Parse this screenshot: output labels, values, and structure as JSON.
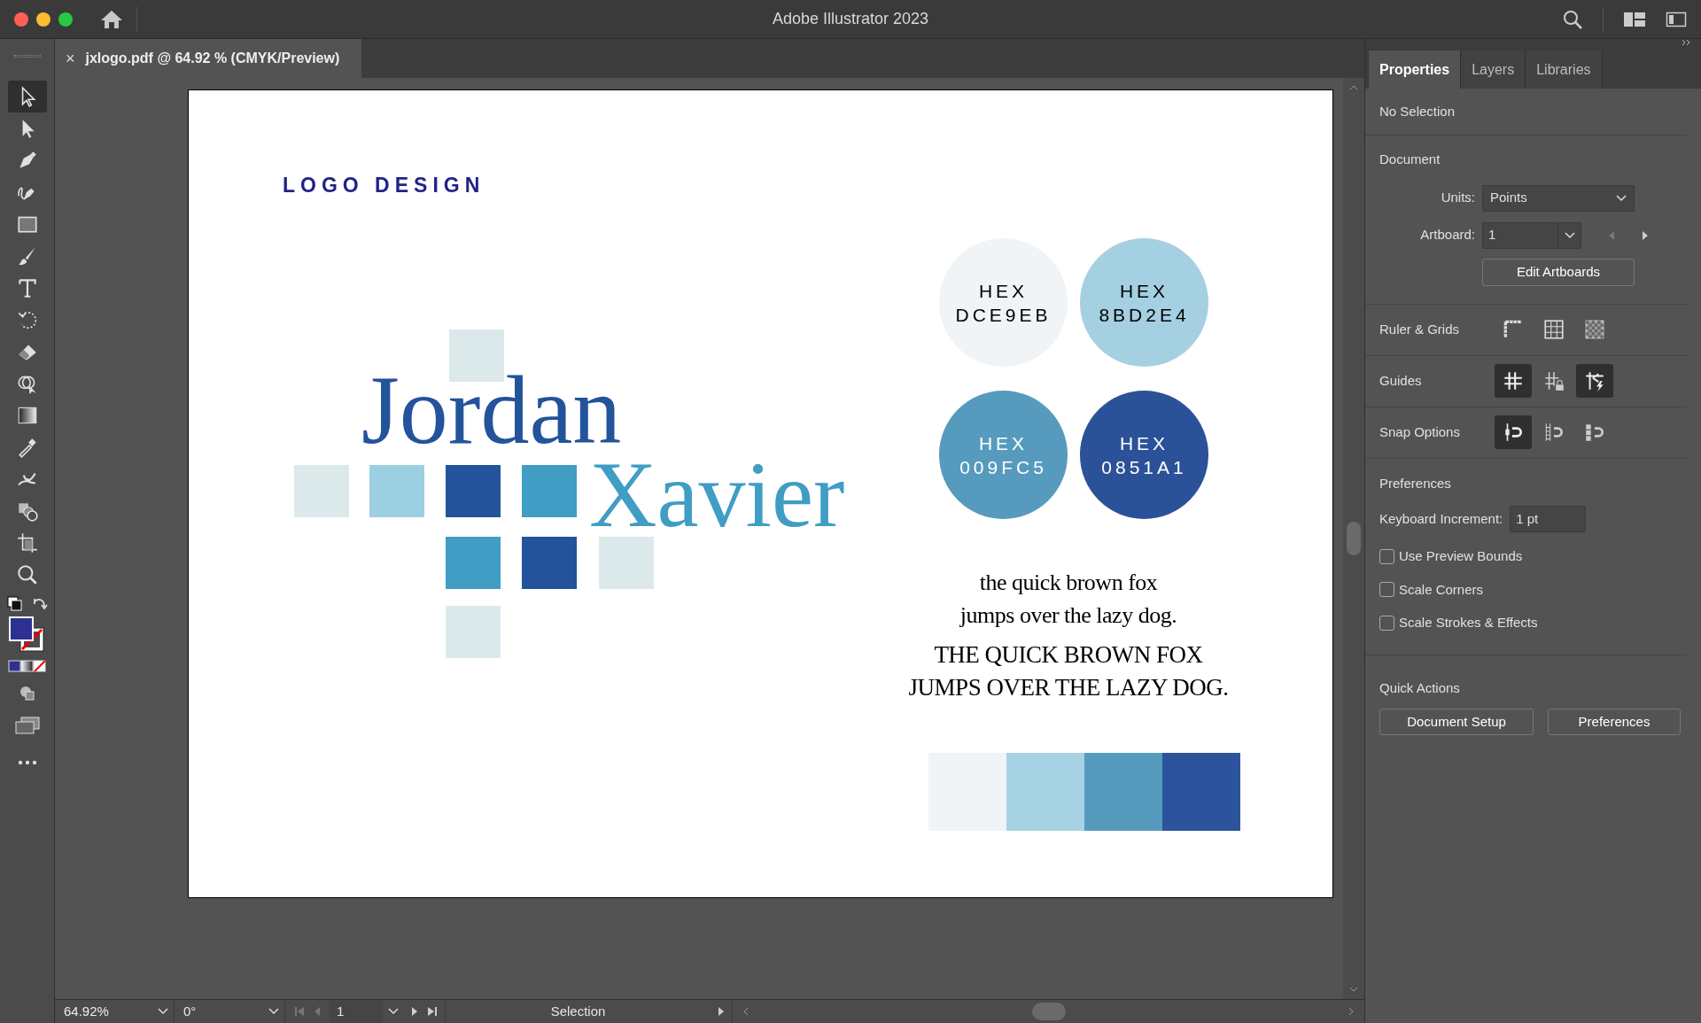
{
  "window": {
    "title": "Adobe Illustrator 2023"
  },
  "document_tab": {
    "close": "×",
    "title": "jxlogo.pdf @ 64.92 % (CMYK/Preview)"
  },
  "tools": [
    {
      "selected": true
    },
    {
      "selected": false
    },
    {
      "selected": false
    },
    {
      "selected": false
    },
    {
      "selected": false
    },
    {
      "selected": false
    },
    {
      "selected": false
    },
    {
      "selected": false
    },
    {
      "selected": false
    },
    {
      "selected": false
    },
    {
      "selected": false
    },
    {
      "selected": false
    },
    {
      "selected": false
    },
    {
      "selected": false
    },
    {
      "selected": false
    },
    {
      "selected": false
    }
  ],
  "artboard": {
    "heading": "LOGO DESIGN",
    "logo": {
      "line_1": "Jordan",
      "line_2": "Xavier"
    },
    "swatches": [
      {
        "label": "HEX",
        "code": "DCE9EB",
        "color": "#f0f4f7"
      },
      {
        "label": "HEX",
        "code": "8BD2E4",
        "color": "#a5d0e2"
      },
      {
        "label": "HEX",
        "code": "009FC5",
        "color": "#569bbd"
      },
      {
        "label": "HEX",
        "code": "0851A1",
        "color": "#2b5298"
      }
    ],
    "pangrams": [
      "the quick brown fox",
      "jumps over the lazy dog.",
      "THE QUICK BROWN FOX",
      "JUMPS OVER THE LAZY DOG."
    ],
    "palette_strip": [
      {
        "color": "#f0f4f7"
      },
      {
        "color": "#a7d2e3"
      },
      {
        "color": "#569bbe"
      },
      {
        "color": "#2b549c"
      }
    ]
  },
  "panel": {
    "tabs": [
      {
        "label": "Properties",
        "selected": true
      },
      {
        "label": "Layers",
        "selected": false
      },
      {
        "label": "Libraries",
        "selected": false
      }
    ],
    "selection": "No Selection",
    "document": {
      "heading": "Document",
      "units_label": "Units:",
      "units": "Points",
      "artboard_label": "Artboard:",
      "artboard": "1",
      "edit_button": "Edit Artboards"
    },
    "toggle_rows": [
      {
        "label": "Ruler & Grids",
        "buttons": [
          {
            "on": false
          },
          {
            "on": false
          },
          {
            "on": false
          }
        ]
      },
      {
        "label": "Guides",
        "buttons": [
          {
            "on": true
          },
          {
            "on": false
          },
          {
            "on": true
          }
        ]
      },
      {
        "label": "Snap Options",
        "buttons": [
          {
            "on": true
          },
          {
            "on": false
          },
          {
            "on": false
          }
        ]
      }
    ],
    "preferences": {
      "heading": "Preferences",
      "increment_label": "Keyboard Increment:",
      "increment": "1 pt",
      "checkboxes": [
        {
          "label": "Use Preview Bounds",
          "checked": false
        },
        {
          "label": "Scale Corners",
          "checked": false
        },
        {
          "label": "Scale Strokes & Effects",
          "checked": false
        }
      ]
    },
    "quick_actions": {
      "heading": "Quick Actions",
      "buttons": [
        "Document Setup",
        "Preferences"
      ]
    }
  },
  "status_bar": {
    "zoom": "64.92%",
    "rotation": "0°",
    "artboard": "1",
    "tool": "Selection"
  }
}
